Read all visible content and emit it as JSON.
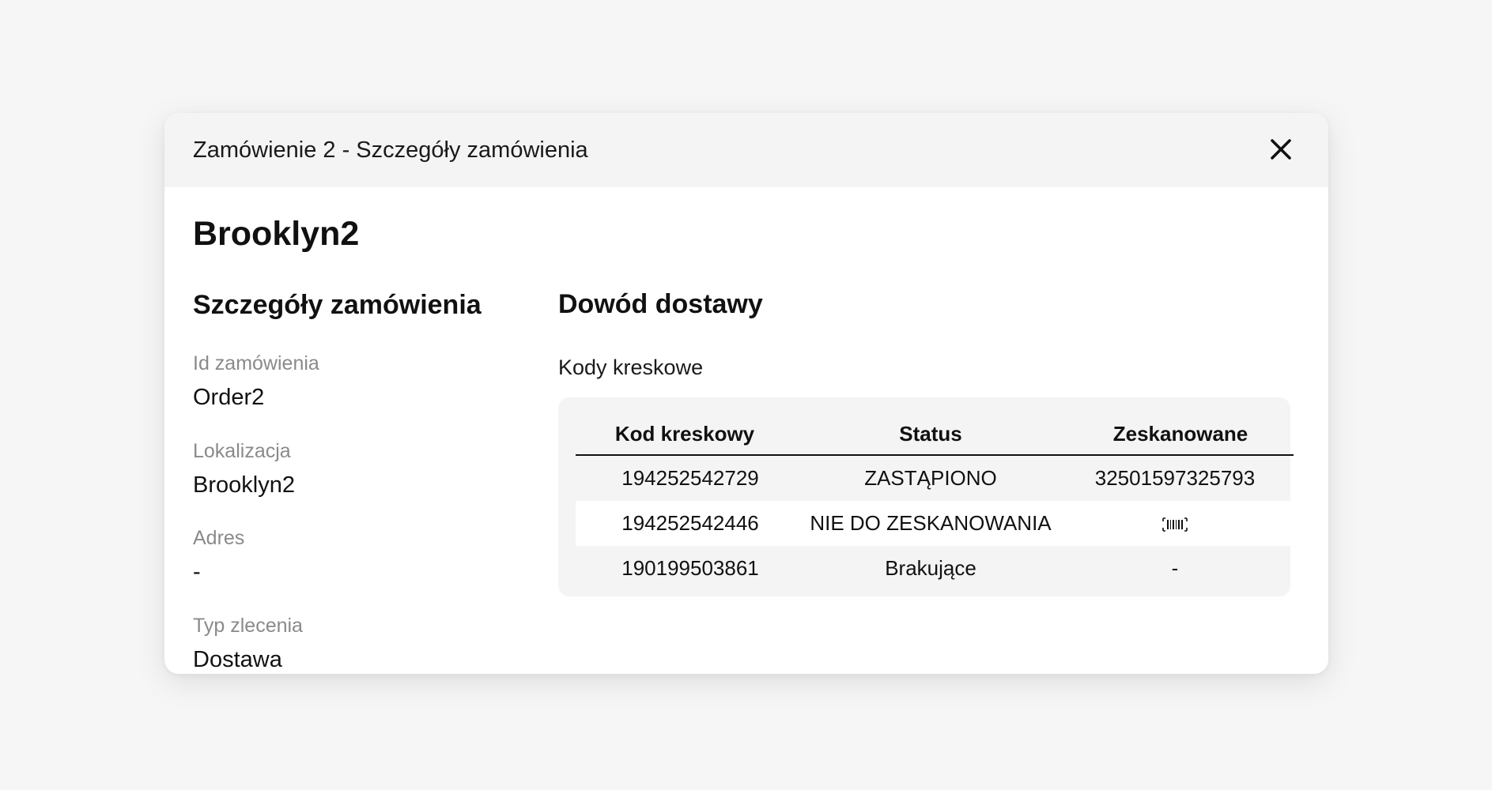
{
  "modal": {
    "title": "Zamówienie 2 - Szczegóły zamówienia",
    "close_icon": "close-icon"
  },
  "location_name": "Brooklyn2",
  "order_details": {
    "heading": "Szczegóły zamówienia",
    "fields": [
      {
        "label": "Id zamówienia",
        "value": "Order2"
      },
      {
        "label": "Lokalizacja",
        "value": "Brooklyn2"
      },
      {
        "label": "Adres",
        "value": "-"
      },
      {
        "label": "Typ zlecenia",
        "value": "Dostawa"
      }
    ]
  },
  "proof_of_delivery": {
    "heading": "Dowód dostawy",
    "barcodes_caption": "Kody kreskowe",
    "table": {
      "columns": [
        "Kod kreskowy",
        "Status",
        "Zeskanowane"
      ],
      "rows": [
        {
          "code": "194252542729",
          "status": "ZASTĄPIONO",
          "scanned": "32501597325793"
        },
        {
          "code": "194252542446",
          "status": "NIE DO ZESKANOWANIA",
          "scanned_icon": "barcode-icon"
        },
        {
          "code": "190199503861",
          "status": "Brakujące",
          "scanned": "-"
        }
      ]
    }
  },
  "colors": {
    "page_background": "#f6f6f6",
    "header_background": "#f4f4f4",
    "panel_background": "#f4f4f4",
    "label_gray": "#8a8a8a",
    "text": "#111111"
  }
}
